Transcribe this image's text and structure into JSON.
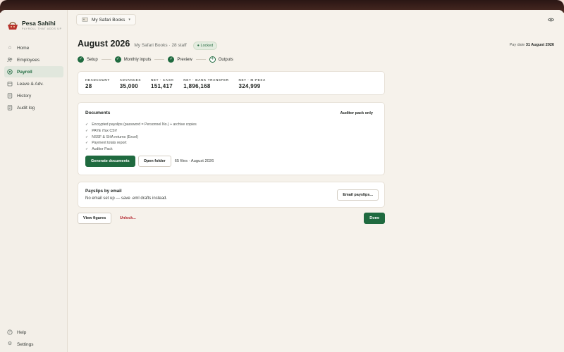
{
  "brand": {
    "name": "Pesa Sahihi",
    "tagline": "PAYROLL THAT ADDS UP"
  },
  "nav": {
    "items": [
      {
        "label": "Home",
        "icon": "home-icon",
        "active": false
      },
      {
        "label": "Employees",
        "icon": "people-icon",
        "active": false
      },
      {
        "label": "Payroll",
        "icon": "payroll-icon",
        "active": true
      },
      {
        "label": "Leave & Adv.",
        "icon": "leave-icon",
        "active": false
      },
      {
        "label": "History",
        "icon": "history-icon",
        "active": false
      },
      {
        "label": "Audit log",
        "icon": "audit-log-icon",
        "active": false
      }
    ],
    "bottom": [
      {
        "label": "Help",
        "icon": "help-icon"
      },
      {
        "label": "Settings",
        "icon": "gear-icon"
      }
    ]
  },
  "header": {
    "company": "My Safari Books"
  },
  "page": {
    "title": "August 2026",
    "subtitle": "My Safari Books · 28 staff",
    "status": "Locked",
    "pay_date_label": "Pay date",
    "pay_date": "31 August 2026"
  },
  "steps": [
    {
      "label": "Setup",
      "state": "done",
      "marker": "✓"
    },
    {
      "label": "Monthly inputs",
      "state": "done",
      "marker": "✓"
    },
    {
      "label": "Preview",
      "state": "done",
      "marker": "✓"
    },
    {
      "label": "Outputs",
      "state": "current",
      "marker": "4"
    }
  ],
  "stats": [
    {
      "label": "HEADCOUNT",
      "value": "28"
    },
    {
      "label": "ADVANCES",
      "value": "35,000"
    },
    {
      "label": "NET · CASH",
      "value": "151,417"
    },
    {
      "label": "NET · BANK TRANSFER",
      "value": "1,896,168"
    },
    {
      "label": "NET · M-PESA",
      "value": "324,999"
    }
  ],
  "documents": {
    "title": "Documents",
    "mode": "Auditor pack only",
    "items": [
      "Encrypted payslips (password = Personnel No.) + archive copies",
      "PAYE iTax CSV",
      "NSSF & SHA returns (Excel)",
      "Payment totals report",
      "Auditor Pack"
    ],
    "generate_label": "Generate documents",
    "open_folder_label": "Open folder",
    "files_note": "65 files · August 2026"
  },
  "email": {
    "title": "Payslips by email",
    "note": "No email set up — save .eml drafts instead.",
    "button_label": "Email payslips..."
  },
  "actions": {
    "view_figures": "View figures",
    "unlock": "Unlock...",
    "done": "Done"
  },
  "colors": {
    "accent": "#1f6a3f",
    "danger": "#b3262e",
    "background": "#f6f2eb"
  }
}
